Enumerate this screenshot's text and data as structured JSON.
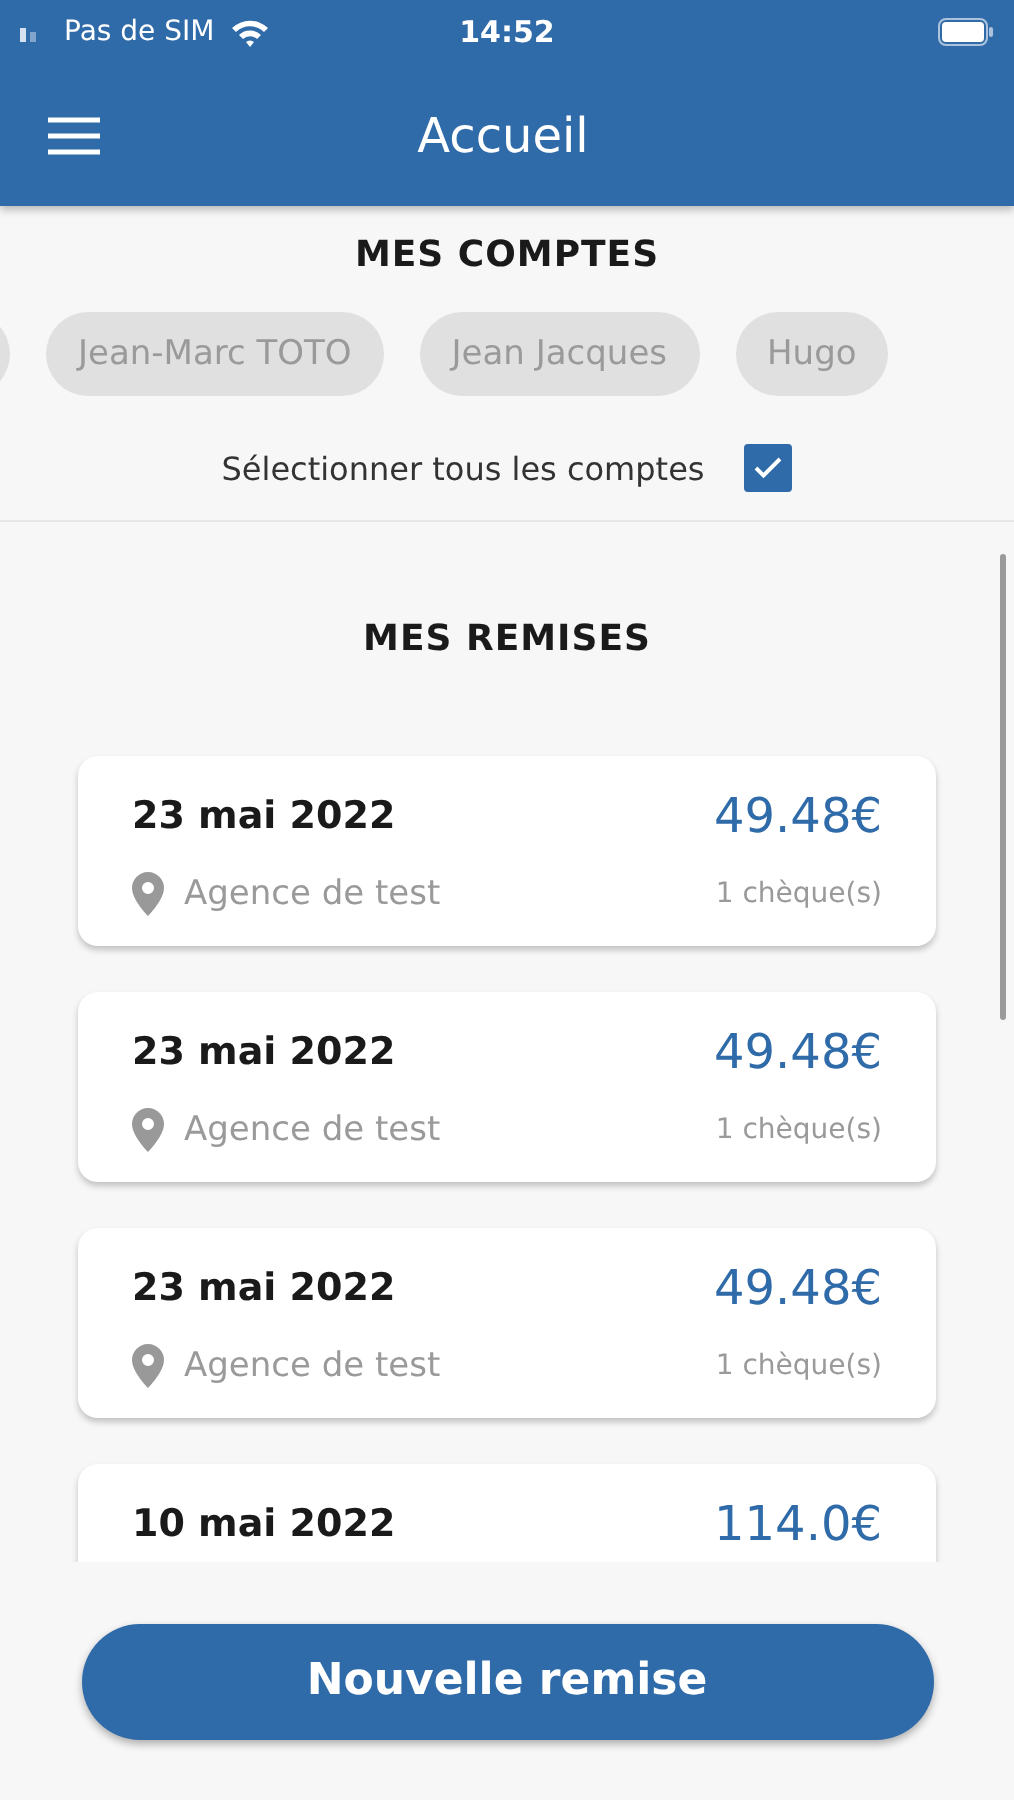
{
  "status_bar": {
    "carrier": "Pas de SIM",
    "time": "14:52"
  },
  "app_bar": {
    "title": "Accueil"
  },
  "accounts": {
    "title": "MES COMPTES",
    "chips": [
      {
        "label": "Jean-Marc TOTO",
        "selected": false
      },
      {
        "label": "Jean Jacques",
        "selected": false
      },
      {
        "label": "Hugo",
        "selected": false
      }
    ],
    "select_all": {
      "label": "Sélectionner tous les comptes",
      "checked": true
    }
  },
  "remises": {
    "title": "MES REMISES",
    "items": [
      {
        "date": "23 mai 2022",
        "amount": "49.48€",
        "agency": "Agence de test",
        "count": "1 chèque(s)"
      },
      {
        "date": "23 mai 2022",
        "amount": "49.48€",
        "agency": "Agence de test",
        "count": "1 chèque(s)"
      },
      {
        "date": "23 mai 2022",
        "amount": "49.48€",
        "agency": "Agence de test",
        "count": "1 chèque(s)"
      },
      {
        "date": "10 mai 2022",
        "amount": "114.0€"
      }
    ]
  },
  "button": {
    "label": "Nouvelle remise"
  }
}
